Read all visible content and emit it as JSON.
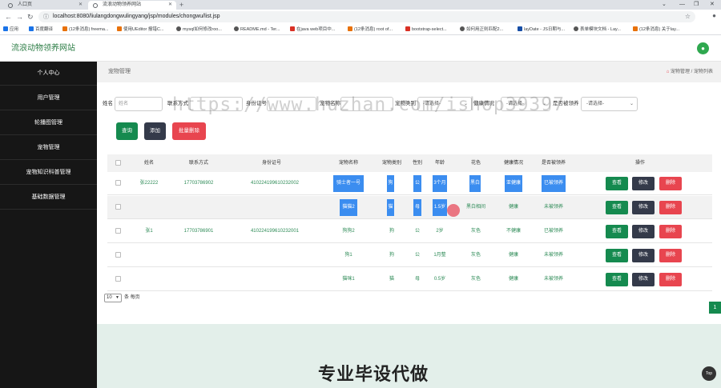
{
  "browser": {
    "tabs": [
      {
        "label": "人口页",
        "active": false
      },
      {
        "label": "流浪动物领养网站",
        "active": true
      }
    ],
    "url": "localhost:8080/liulangdongwulingyang/jsp/modules/chongwu/list.jsp",
    "bookmarks": [
      "应用",
      "百度翻译",
      "(12条消息) freema...",
      "使用UEditor 报错C...",
      "mysql如何修改roo...",
      "README.md - Ter...",
      "在java web项目中...",
      "(12条消息) root of...",
      "bootstrap-select...",
      "如何用正则匹配2...",
      "layDate - JS日期与...",
      "表单模块文档 - Lay...",
      "(12条消息) 关于lay..."
    ]
  },
  "header": {
    "site_title": "流浪动物领养网站",
    "user_icon": "user-icon"
  },
  "sidebar": {
    "items": [
      {
        "label": "个人中心"
      },
      {
        "label": "用户管理"
      },
      {
        "label": "轮播图管理"
      },
      {
        "label": "宠物管理"
      },
      {
        "label": "宠物知识科普管理"
      },
      {
        "label": "基础数据管理"
      }
    ]
  },
  "page": {
    "title": "宠物管理",
    "breadcrumb": "宠物管理 / 宠物列表",
    "breadcrumb_icon": "home-icon"
  },
  "filters": {
    "name_label": "姓名",
    "name_placeholder": "姓名",
    "phone_label": "联系方式",
    "idcard_label": "身份证号",
    "petname_label": "宠物名称",
    "pettype_label": "宠物类别",
    "health_label": "健康情况",
    "adopted_label": "是否被领养",
    "select_placeholder": "-请选择-"
  },
  "buttons": {
    "search": "查询",
    "add": "添加",
    "batch_delete": "批量删除"
  },
  "table": {
    "headers": [
      "姓名",
      "联系方式",
      "身份证号",
      "宠物名称",
      "宠物类别",
      "性别",
      "年龄",
      "花色",
      "健康情况",
      "是否被领养",
      "操作"
    ],
    "rows": [
      {
        "name": "张22222",
        "phone": "17703786902",
        "idcard": "410224199610232002",
        "petname": "骑士者一号",
        "pettype": "狗",
        "gender": "公",
        "age": "3个月",
        "color": "黑白",
        "health": "亚健康",
        "adopted": "已被领养"
      },
      {
        "name": "",
        "phone": "",
        "idcard": "",
        "petname": "猫猫2",
        "pettype": "猫",
        "gender": "母",
        "age": "1.5岁",
        "color": "黑白相间",
        "health": "健康",
        "adopted": "未被领养"
      },
      {
        "name": "张1",
        "phone": "17703786901",
        "idcard": "410224199610232001",
        "petname": "狗狗2",
        "pettype": "狗",
        "gender": "公",
        "age": "2岁",
        "color": "灰色",
        "health": "不健康",
        "adopted": "已被领养"
      },
      {
        "name": "",
        "phone": "",
        "idcard": "",
        "petname": "狗1",
        "pettype": "狗",
        "gender": "公",
        "age": "1月整",
        "color": "灰色",
        "health": "健康",
        "adopted": "未被领养"
      },
      {
        "name": "",
        "phone": "",
        "idcard": "",
        "petname": "猫咪1",
        "pettype": "猫",
        "gender": "母",
        "age": "0.5岁",
        "color": "灰色",
        "health": "健康",
        "adopted": "未被领养"
      }
    ],
    "row_actions": {
      "view": "查看",
      "edit": "修改",
      "delete": "删除"
    }
  },
  "pagination": {
    "page_size": "10",
    "per_page_label": "条 每页",
    "current_page": "1"
  },
  "footer": {
    "banner_text": "专业毕设代做",
    "top_button": "Top"
  },
  "watermark": "https://www.huzhan.com/ishop39397"
}
